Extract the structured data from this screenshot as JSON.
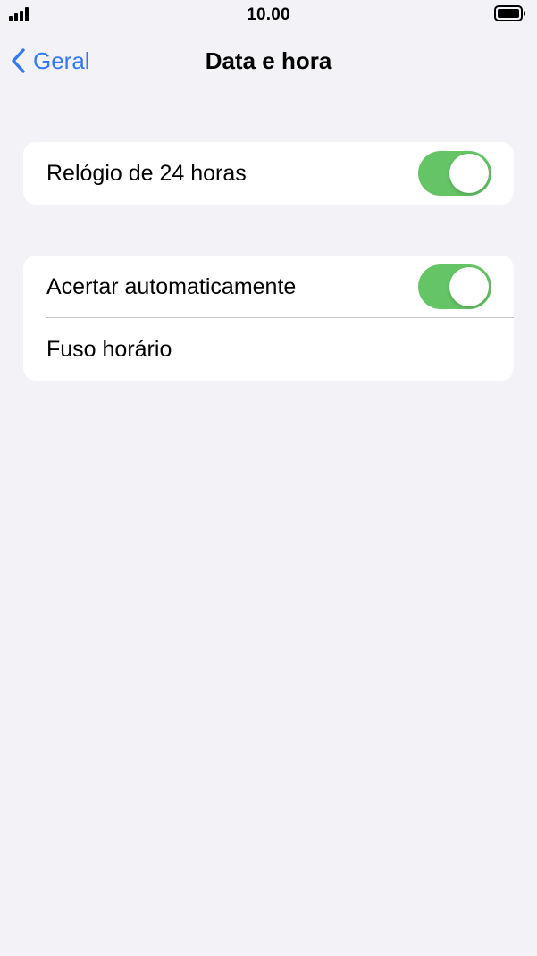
{
  "status_bar": {
    "time": "10.00",
    "signal_icon": "cellular-signal-icon",
    "battery_icon": "battery-full-icon"
  },
  "nav": {
    "back_label": "Geral",
    "back_icon": "chevron-left-icon",
    "title": "Data e hora"
  },
  "sections": [
    {
      "rows": [
        {
          "label": "Relógio de 24 horas",
          "control": "toggle",
          "on": true
        }
      ]
    },
    {
      "rows": [
        {
          "label": "Acertar automaticamente",
          "control": "toggle",
          "on": true
        },
        {
          "label": "Fuso horário",
          "control": "none"
        }
      ]
    }
  ],
  "colors": {
    "accent": "#3478f6",
    "toggle_on": "#65c466",
    "background": "#f2f2f7",
    "card": "#ffffff",
    "separator": "#c6c6c8"
  }
}
